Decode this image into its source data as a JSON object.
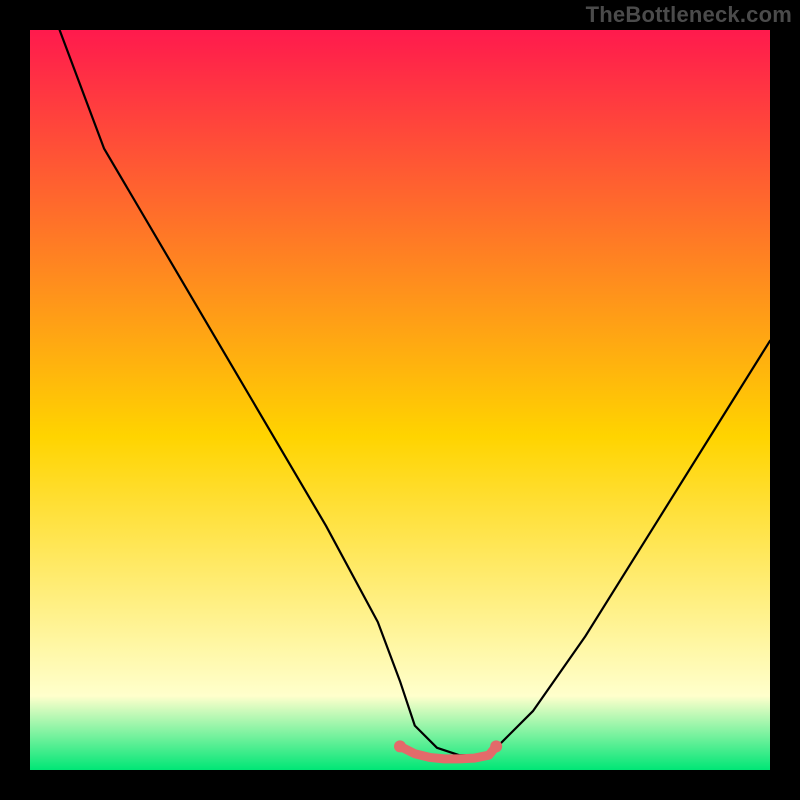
{
  "watermark": "TheBottleneck.com",
  "chart_data": {
    "type": "line",
    "title": "",
    "xlabel": "",
    "ylabel": "",
    "xlim": [
      0,
      100
    ],
    "ylim": [
      0,
      100
    ],
    "background_gradient": {
      "top": "#ff1a4d",
      "middle": "#ffd400",
      "bottom_yellow_white": "#ffffcc",
      "bottom": "#00e676"
    },
    "series": [
      {
        "name": "bottleneck-curve",
        "color": "#000000",
        "x": [
          4,
          10,
          20,
          30,
          40,
          47,
          50,
          52,
          55,
          58,
          61,
          63,
          68,
          75,
          85,
          95,
          100
        ],
        "values": [
          100,
          84,
          67,
          50,
          33,
          20,
          12,
          6,
          3,
          2,
          2,
          3,
          8,
          18,
          34,
          50,
          58
        ]
      },
      {
        "name": "optimal-range-marker",
        "color": "#e36a6a",
        "x": [
          50,
          52,
          54,
          56,
          58,
          60,
          62,
          63
        ],
        "values": [
          3.2,
          2.2,
          1.7,
          1.5,
          1.5,
          1.6,
          2.0,
          3.2
        ]
      }
    ],
    "intervals": {
      "optimal_start_x": 50,
      "optimal_end_x": 63
    }
  }
}
